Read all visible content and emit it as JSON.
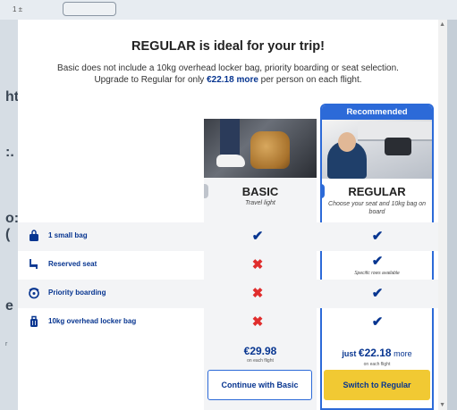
{
  "background": {
    "top_mini": "1 ±",
    "left_fragments": [
      "ht",
      ":.",
      "o:(",
      "e",
      "r"
    ]
  },
  "modal": {
    "title": "REGULAR is ideal for your trip!",
    "subtitle_line1": "Basic does not include a 10kg overhead locker bag, priority boarding or seat selection.",
    "subtitle_line2_pre": "Upgrade to Regular for only ",
    "subtitle_line2_price": "€22.18 more",
    "subtitle_line2_post": " per person on each flight."
  },
  "plans": {
    "basic": {
      "name": "BASIC",
      "description": "Travel light",
      "price": "€29.98",
      "price_note": "on each flight",
      "button": "Continue with Basic"
    },
    "regular": {
      "badge": "Recommended",
      "name": "REGULAR",
      "description": "Choose your seat and 10kg bag on board",
      "price_prefix": "just ",
      "price": "€22.18",
      "price_suffix": " more",
      "price_note": "on each flight",
      "button": "Switch to Regular"
    }
  },
  "features": [
    {
      "label": "1 small bag",
      "icon": "small-bag-icon",
      "basic": "check",
      "regular": "check",
      "regular_note": ""
    },
    {
      "label": "Reserved seat",
      "icon": "seat-icon",
      "basic": "cross",
      "regular": "check",
      "regular_note": "Specific rows available"
    },
    {
      "label": "Priority boarding",
      "icon": "priority-boarding-icon",
      "basic": "cross",
      "regular": "check",
      "regular_note": ""
    },
    {
      "label": "10kg overhead locker bag",
      "icon": "overhead-bag-icon",
      "basic": "cross",
      "regular": "check",
      "regular_note": ""
    }
  ],
  "colors": {
    "brand_blue": "#073590",
    "accent_blue": "#2c6ad8",
    "cta_yellow": "#f1c933",
    "cross_red": "#e02d2d"
  }
}
